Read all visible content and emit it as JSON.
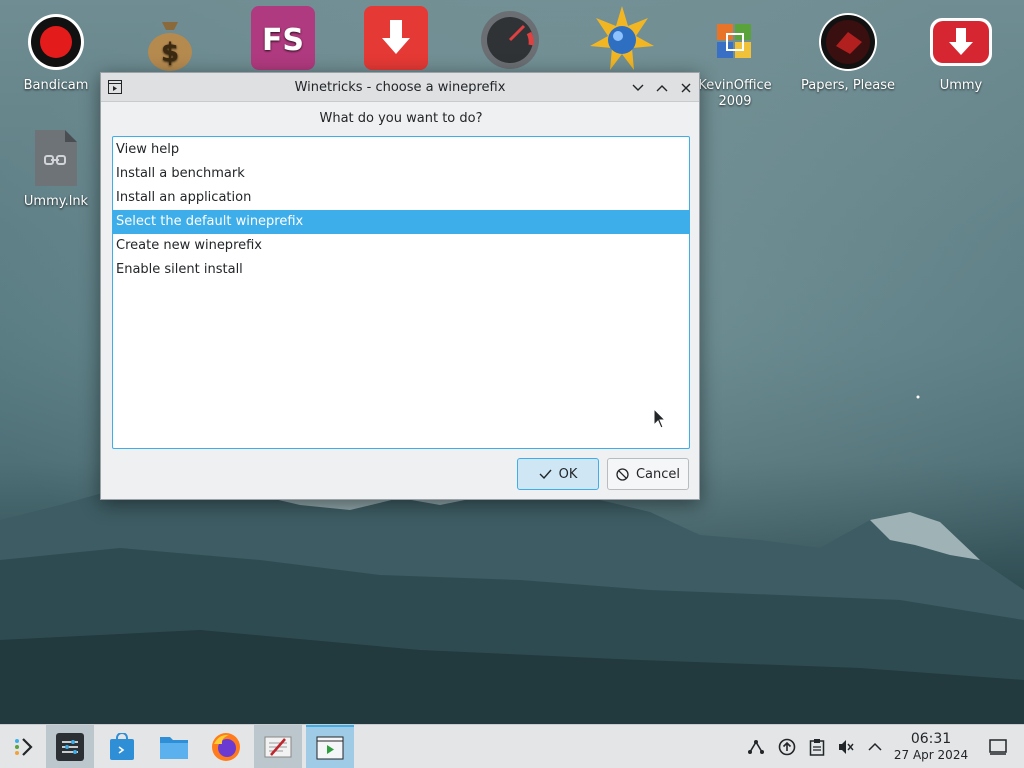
{
  "desktop": {
    "icons": [
      {
        "label": "Bandicam"
      },
      {
        "label": "Ummy.lnk"
      },
      {
        "label": "KevinOffice\n2009"
      },
      {
        "label": "Papers, Please"
      },
      {
        "label": "Ummy"
      }
    ]
  },
  "dialog": {
    "title": "Winetricks - choose a wineprefix",
    "prompt": "What do you want to do?",
    "options": [
      "View help",
      "Install a benchmark",
      "Install an application",
      "Select the default wineprefix",
      "Create new wineprefix",
      "Enable silent install"
    ],
    "selected_index": 3,
    "ok_label": "OK",
    "cancel_label": "Cancel"
  },
  "taskbar": {
    "time": "06:31",
    "date": "27 Apr 2024"
  },
  "colors": {
    "accent": "#3daee9",
    "selection_text": "#ffffff"
  }
}
